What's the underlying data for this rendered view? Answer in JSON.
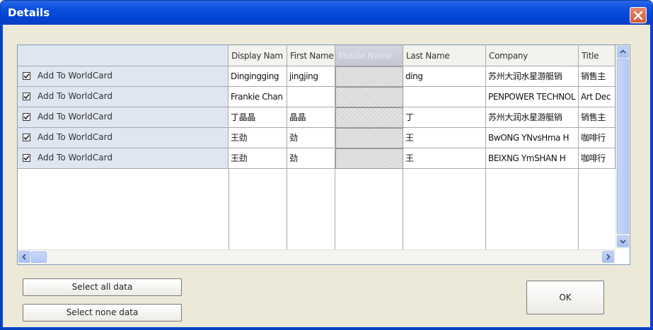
{
  "window": {
    "title": "Details"
  },
  "grid": {
    "checkbox_label": "Add To WorldCard",
    "columns": [
      "Display Nam",
      "First Name",
      "Middle Name",
      "Last Name",
      "Company",
      "Title"
    ],
    "rows": [
      {
        "checked": true,
        "display": "Dingingging",
        "first": "jingjing",
        "middle": "",
        "last": "ding",
        "company": "苏州大润水星游艇销",
        "title": "销售主"
      },
      {
        "checked": true,
        "display": "Frankie Chan",
        "first": "",
        "middle": "",
        "last": "",
        "company": "PENPOWER TECHNOL",
        "title": "Art Dec"
      },
      {
        "checked": true,
        "display": "丁晶晶",
        "first": "晶晶",
        "middle": "",
        "last": "丁",
        "company": "苏州大润水星游艇销",
        "title": "销售主"
      },
      {
        "checked": true,
        "display": "王劲",
        "first": "劲",
        "middle": "",
        "last": "王",
        "company": "BwONG YNvsHma H",
        "title": "咖啡行"
      },
      {
        "checked": true,
        "display": "王劲",
        "first": "劲",
        "middle": "",
        "last": "王",
        "company": "BEIXNG YmSHAN H",
        "title": "咖啡行"
      }
    ]
  },
  "buttons": {
    "select_all": "Select all data",
    "select_none": "Select none data",
    "ok": "OK"
  },
  "colors": {
    "titlebar": "#0244d3",
    "dialog_bg": "#ece9d8",
    "row_header": "#dfe6f1",
    "close_button": "#d55a37"
  }
}
